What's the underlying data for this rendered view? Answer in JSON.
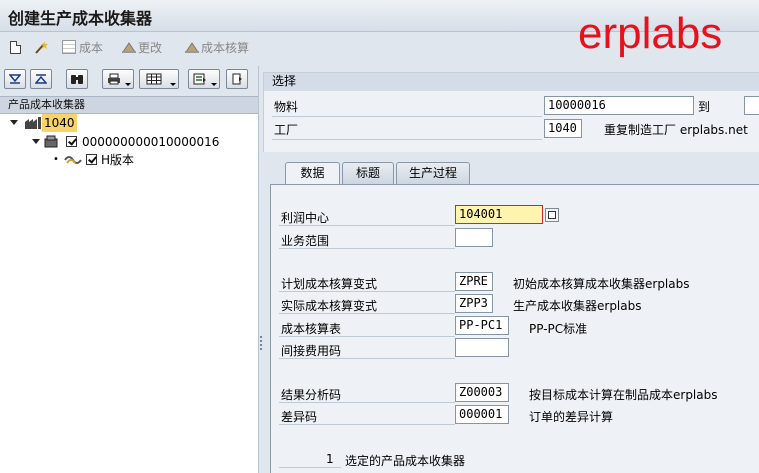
{
  "window": {
    "title": "创建生产成本收集器",
    "brand": "erplabs"
  },
  "app_toolbar": {
    "items": [
      {
        "label": "",
        "icon": "new-document-icon",
        "enabled": true
      },
      {
        "label": "",
        "icon": "magic-wand-icon",
        "enabled": true
      },
      {
        "label": "成本",
        "icon": "costing-grid-icon",
        "enabled": false
      },
      {
        "label": "更改",
        "icon": "change-icon",
        "enabled": false
      },
      {
        "label": "成本核算",
        "icon": "cost-estimate-icon",
        "enabled": false
      }
    ]
  },
  "tree": {
    "header": "产品成本收集器",
    "nodes": [
      {
        "label": "1040",
        "icon": "plant-icon",
        "selected": true
      },
      {
        "label": "000000000010000016",
        "icon": "material-icon",
        "checked": true
      },
      {
        "label": "H版本",
        "icon": "version-icon",
        "checked": true
      }
    ]
  },
  "selection": {
    "header": "选择",
    "material_label": "物料",
    "material_value": "10000016",
    "to_label": "到",
    "to_value": "",
    "plant_label": "工厂",
    "plant_value": "1040",
    "plant_desc": "重复制造工厂 erplabs.net"
  },
  "tabs": [
    {
      "label": "数据",
      "active": true
    },
    {
      "label": "标题",
      "active": false
    },
    {
      "label": "生产过程",
      "active": false
    }
  ],
  "data_tab": {
    "profit_center_label": "利润中心",
    "profit_center_value": "104001",
    "business_area_label": "业务范围",
    "business_area_value": "",
    "plan_variant_label": "计划成本核算变式",
    "plan_variant_value": "ZPRE",
    "plan_variant_desc": "初始成本核算成本收集器erplabs",
    "actual_variant_label": "实际成本核算变式",
    "actual_variant_value": "ZPP3",
    "actual_variant_desc": "生产成本收集器erplabs",
    "costing_sheet_label": "成本核算表",
    "costing_sheet_value": "PP-PC1",
    "costing_sheet_desc": "PP-PC标准",
    "overhead_key_label": "间接费用码",
    "overhead_key_value": "",
    "ra_key_label": "结果分析码",
    "ra_key_value": "Z00003",
    "ra_key_desc": "按目标成本计算在制品成本erplabs",
    "variance_key_label": "差异码",
    "variance_key_value": "000001",
    "variance_key_desc": "订单的差异计算",
    "selected_count": "1",
    "selected_label": "选定的产品成本收集器"
  }
}
